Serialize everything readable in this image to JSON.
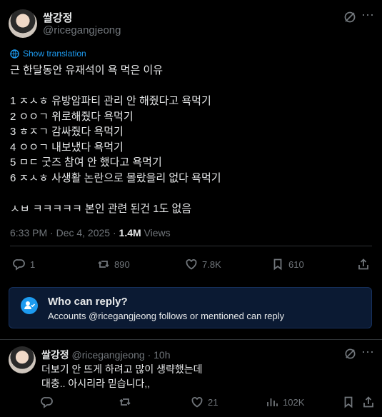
{
  "post": {
    "author_name": "쌀강정",
    "handle": "@ricegangjeong",
    "show_translation": "Show translation",
    "lines": [
      "근 한달동안 유재석이 욕 먹은 이유",
      "",
      "1 ㅈㅅㅎ 유방암파티 관리 안 해줬다고 욕먹기",
      "2 ㅇㅇㄱ 위로해줬다 욕먹기",
      "3 ㅎㅈㄱ 감싸줬다 욕먹기",
      "4 ㅇㅇㄱ 내보냈다 욕먹기",
      "5 ㅁㄷ 굿즈 참여 안 했다고 욕먹기",
      "6 ㅈㅅㅎ 사생활 논란으로 몰랐을리 없다 욕먹기",
      "",
      "ㅅㅂ ㅋㅋㅋㅋㅋ 본인 관련 된건 1도 없음"
    ],
    "timestamp": "6:33 PM · Dec 4, 2025 · ",
    "views_count": "1.4M",
    "views_label": " Views",
    "actions": {
      "replies": "1",
      "reposts": "890",
      "likes": "7.8K",
      "bookmarks": "610"
    }
  },
  "reply_restriction": {
    "title": "Who can reply?",
    "description": "Accounts @ricegangjeong follows or mentioned can reply"
  },
  "reply": {
    "author_name": "쌀강정",
    "handle": "@ricegangjeong",
    "time": " · 10h",
    "lines": [
      "더보기 안 뜨게 하려고 많이 생략했는데",
      "대충.. 아시리라 믿습니다,,"
    ],
    "actions": {
      "reposts": "",
      "likes": "21",
      "views": "102K"
    }
  },
  "colors": {
    "accent": "#1d9bf0",
    "muted": "#71767b",
    "background": "#000000"
  }
}
